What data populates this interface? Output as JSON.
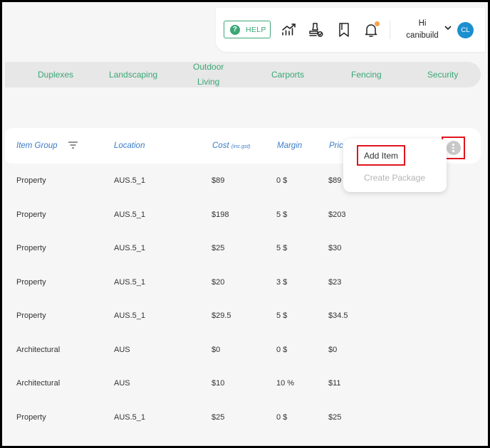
{
  "header": {
    "help_label": "HELP",
    "greeting_line1": "Hi",
    "greeting_line2": "canibuild",
    "avatar_initials": "CL",
    "icons": [
      "chart-icon",
      "stamp-icon",
      "bookmark-icon",
      "bell-icon"
    ],
    "accent": "#3aa776",
    "avatar_color": "#1b8fcf"
  },
  "categories": [
    "Duplexes",
    "Landscaping",
    "Outdoor\nLiving",
    "Carports",
    "Fencing",
    "Security"
  ],
  "table": {
    "columns": {
      "item_group": "Item Group",
      "location": "Location",
      "cost": "Cost",
      "cost_note": "(inc.gst)",
      "margin": "Margin",
      "price": "Pric"
    },
    "rows": [
      {
        "group": "Property",
        "location": "AUS.5_1",
        "cost": "$89",
        "margin": "0 $",
        "price": "$89"
      },
      {
        "group": "Property",
        "location": "AUS.5_1",
        "cost": "$198",
        "margin": "5 $",
        "price": "$203"
      },
      {
        "group": "Property",
        "location": "AUS.5_1",
        "cost": "$25",
        "margin": "5 $",
        "price": "$30"
      },
      {
        "group": "Property",
        "location": "AUS.5_1",
        "cost": "$20",
        "margin": "3 $",
        "price": "$23"
      },
      {
        "group": "Property",
        "location": "AUS.5_1",
        "cost": "$29.5",
        "margin": "5 $",
        "price": "$34.5"
      },
      {
        "group": "Architectural",
        "location": "AUS",
        "cost": "$0",
        "margin": "0 $",
        "price": "$0"
      },
      {
        "group": "Architectural",
        "location": "AUS",
        "cost": "$10",
        "margin": "10 %",
        "price": "$11"
      },
      {
        "group": "Property",
        "location": "AUS.5_1",
        "cost": "$25",
        "margin": "0 $",
        "price": "$25"
      }
    ]
  },
  "menu": {
    "add_item": "Add Item",
    "create_package": "Create Package"
  }
}
